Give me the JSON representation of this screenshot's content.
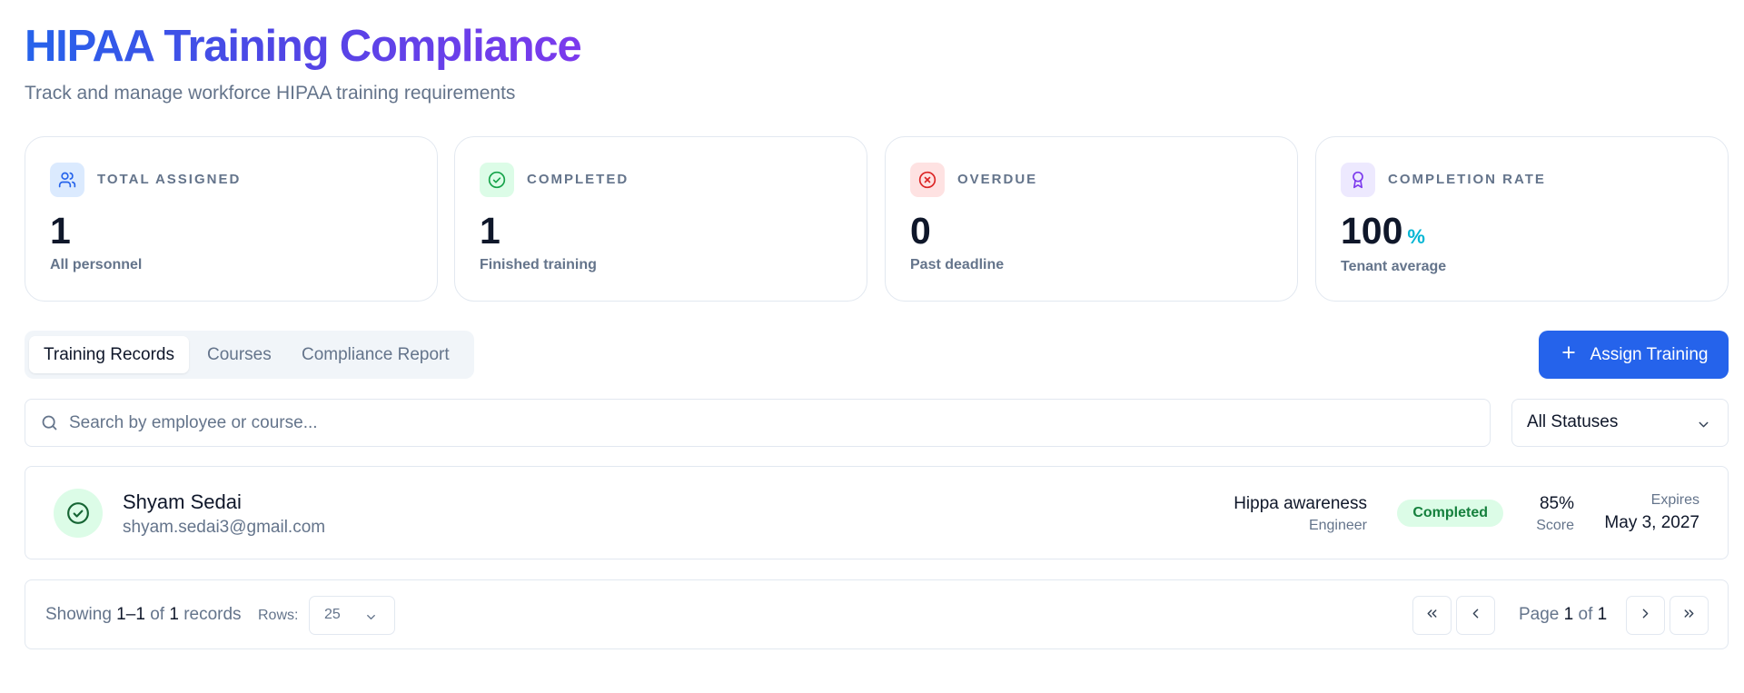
{
  "header": {
    "title": "HIPAA Training Compliance",
    "subtitle": "Track and manage workforce HIPAA training requirements"
  },
  "stats": [
    {
      "label": "TOTAL ASSIGNED",
      "value": "1",
      "sub": "All personnel",
      "icon": "users-icon",
      "color": "#2563eb",
      "bg": "#dbeafe"
    },
    {
      "label": "COMPLETED",
      "value": "1",
      "sub": "Finished training",
      "icon": "check-circle-icon",
      "color": "#16a34a",
      "bg": "#dcfce7"
    },
    {
      "label": "OVERDUE",
      "value": "0",
      "sub": "Past deadline",
      "icon": "x-circle-icon",
      "color": "#dc2626",
      "bg": "#fee2e2"
    },
    {
      "label": "COMPLETION RATE",
      "value": "100",
      "unit": "%",
      "sub": "Tenant average",
      "icon": "award-icon",
      "color": "#7c3aed",
      "bg": "#ede9fe"
    }
  ],
  "tabs": [
    {
      "label": "Training Records",
      "active": true
    },
    {
      "label": "Courses",
      "active": false
    },
    {
      "label": "Compliance Report",
      "active": false
    }
  ],
  "assign_button": {
    "label": "Assign Training",
    "icon": "plus-icon"
  },
  "search": {
    "placeholder": "Search by employee or course...",
    "value": ""
  },
  "status_filter": {
    "selected": "All Statuses"
  },
  "records": [
    {
      "name": "Shyam Sedai",
      "email": "shyam.sedai3@gmail.com",
      "course": "Hippa awareness",
      "role": "Engineer",
      "status": "Completed",
      "score": "85%",
      "score_label": "Score",
      "expires_label": "Expires",
      "expires": "May 3, 2027"
    }
  ],
  "pagination": {
    "showing_prefix": "Showing",
    "range_start": "1",
    "range_sep": "–",
    "range_end": "1",
    "of_word": "of",
    "total": "1",
    "records_word": "records",
    "rows_label": "Rows:",
    "rows_value": "25",
    "page_word": "Page",
    "page": "1",
    "page_total": "1"
  },
  "colors": {
    "accent": "#2563eb",
    "title_gradient_start": "#2563eb",
    "title_gradient_end": "#7c3aed",
    "success": "#16a34a",
    "danger": "#dc2626"
  }
}
